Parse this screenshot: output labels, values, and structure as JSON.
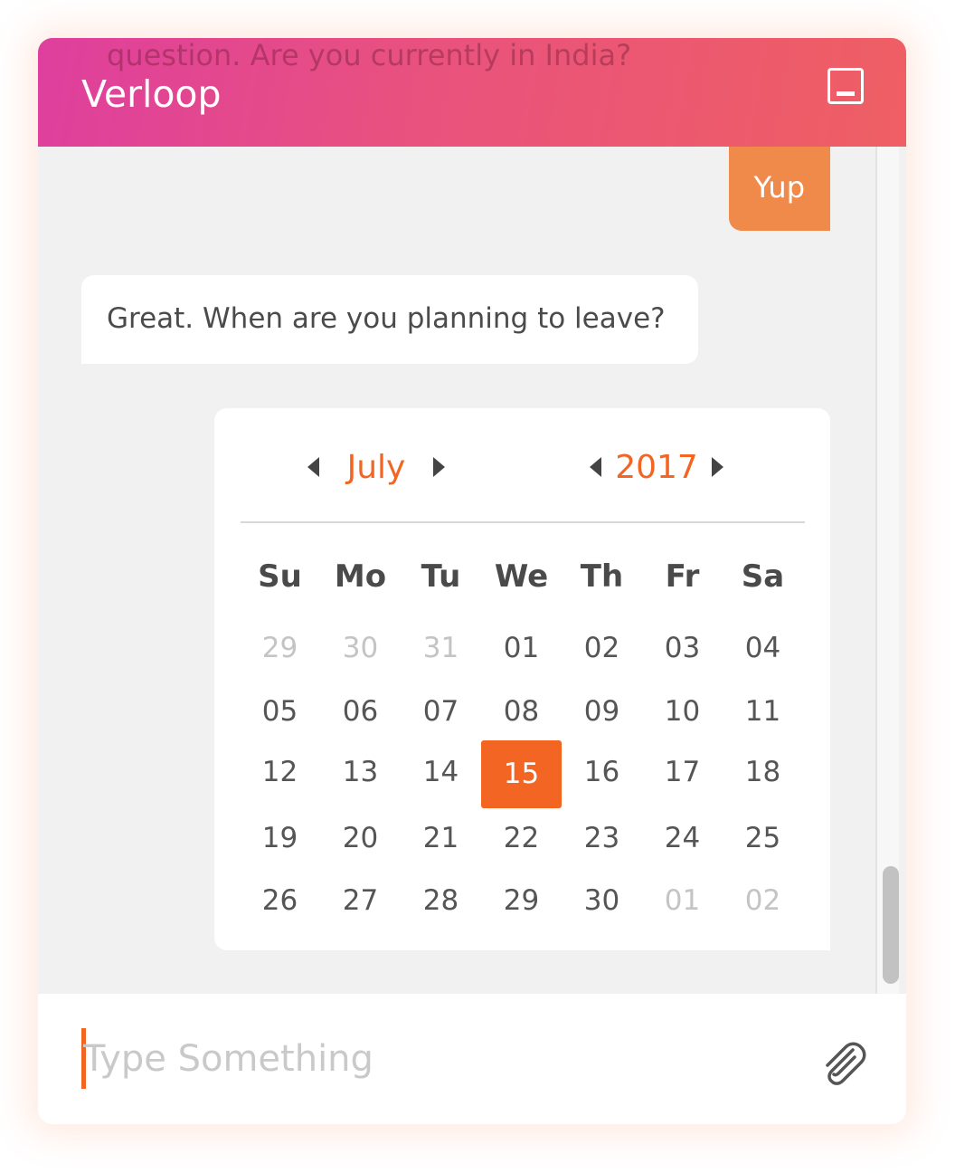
{
  "header": {
    "scrolled_message": "question. Are you currently in India?",
    "title": "Verloop",
    "minimize_icon": "minimize-icon"
  },
  "messages": {
    "user_reply": "Yup",
    "bot_question": "Great. When are you planning to leave?"
  },
  "calendar": {
    "month": "July",
    "year": "2017",
    "weekdays": [
      "Su",
      "Mo",
      "Tu",
      "We",
      "Th",
      "Fr",
      "Sa"
    ],
    "weeks": [
      [
        "29",
        "30",
        "31",
        "01",
        "02",
        "03",
        "04"
      ],
      [
        "05",
        "06",
        "07",
        "08",
        "09",
        "10",
        "11"
      ],
      [
        "12",
        "13",
        "14",
        "15",
        "16",
        "17",
        "18"
      ],
      [
        "19",
        "20",
        "21",
        "22",
        "23",
        "24",
        "25"
      ],
      [
        "26",
        "27",
        "28",
        "29",
        "30",
        "01",
        "02"
      ]
    ],
    "selected_day": "15",
    "accent_color": "#f26522"
  },
  "composer": {
    "placeholder": "Type Something",
    "value": "",
    "attach_icon": "paperclip-icon"
  },
  "colors": {
    "header_gradient_start": "#de3f9e",
    "header_gradient_end": "#ef5f63",
    "user_bubble": "#f08a4b"
  }
}
